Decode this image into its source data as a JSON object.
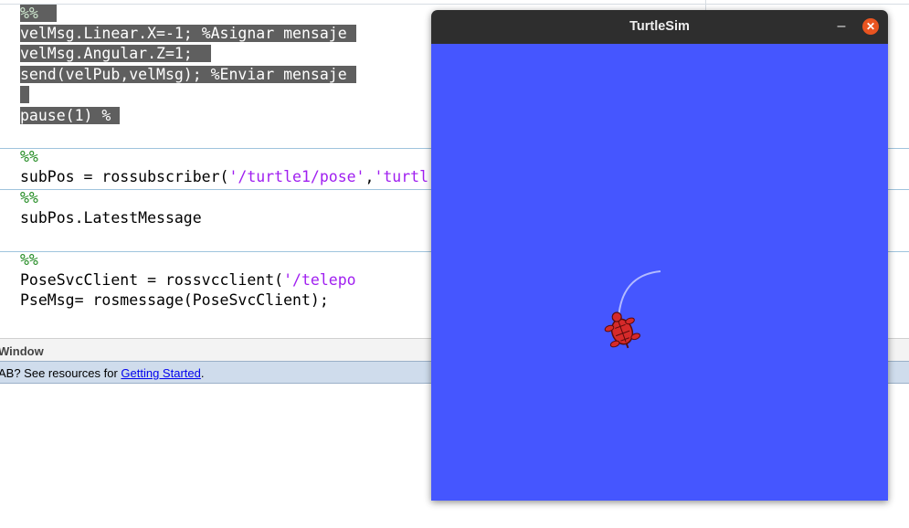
{
  "editor": {
    "lines_selected": [
      {
        "code": "%%",
        "comment": ""
      },
      {
        "code": "velMsg.Linear.X=-1; ",
        "comment": "%Asignar mensaje "
      },
      {
        "code": "velMsg.Angular.Z=1;  ",
        "comment": ""
      },
      {
        "code": "send(velPub,velMsg); ",
        "comment": "%Enviar mensaje "
      },
      {
        "code": " ",
        "comment": ""
      },
      {
        "code": "pause(1) ",
        "comment": "% "
      }
    ],
    "section2": {
      "marker": "%%",
      "prefix": "subPos = rossubscriber(",
      "str1": "'/turtle1/pose'",
      "comma": ",",
      "str2": "'turtl"
    },
    "section3": {
      "marker": "%%",
      "line": "subPos.LatestMessage"
    },
    "section4": {
      "marker": "%%",
      "prefix": "PoseSvcClient = rossvcclient(",
      "str1": "'/telepo",
      "line2": "PseMsg= rosmessage(PoseSvcClient);"
    }
  },
  "command_window": {
    "title": "Window",
    "info_prefix": "AB? See resources for ",
    "info_link": "Getting Started",
    "info_suffix": "."
  },
  "turtlesim": {
    "title": "TurtleSim",
    "minimize": "–",
    "close": "✕",
    "background_color": "#4556ff",
    "turtle_icon": "turtle-icon"
  }
}
